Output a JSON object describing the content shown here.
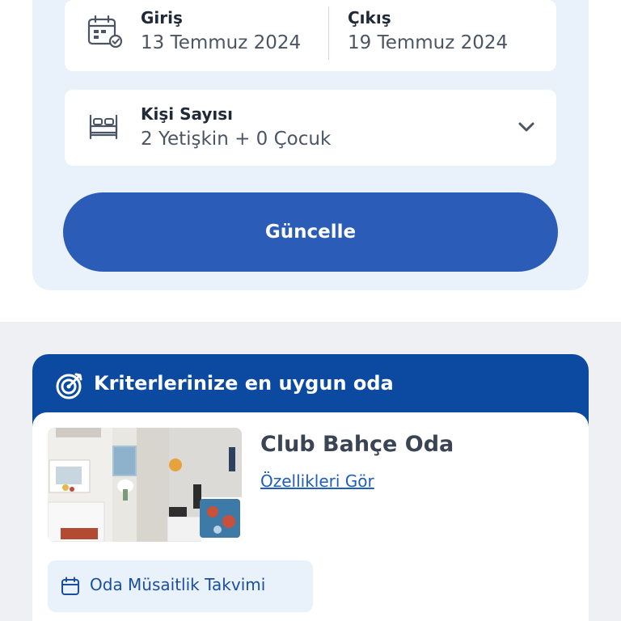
{
  "search": {
    "checkin": {
      "label": "Giriş",
      "value": "13 Temmuz 2024"
    },
    "checkout": {
      "label": "Çıkış",
      "value": "19 Temmuz 2024"
    },
    "guests": {
      "label": "Kişi Sayısı",
      "value": "2 Yetişkin + 0 Çocuk"
    },
    "update_label": "Güncelle"
  },
  "results": {
    "header": "Kriterlerinize en uygun oda",
    "room": {
      "name": "Club Bahçe Oda",
      "details_link": "Özellikleri Gör",
      "calendar_label": "Oda Müsaitlik Takvimi"
    }
  },
  "icons": {
    "calendar": "calendar-check-icon",
    "bed": "bed-icon",
    "dropdown": "chevron-down-icon",
    "target": "target-icon",
    "availability": "calendar-icon"
  },
  "colors": {
    "primary_button": "#2b5cb7",
    "header_blue": "#0b4aa0",
    "panel_bg": "#e9f1fb",
    "link_blue": "#1f5fb8"
  }
}
